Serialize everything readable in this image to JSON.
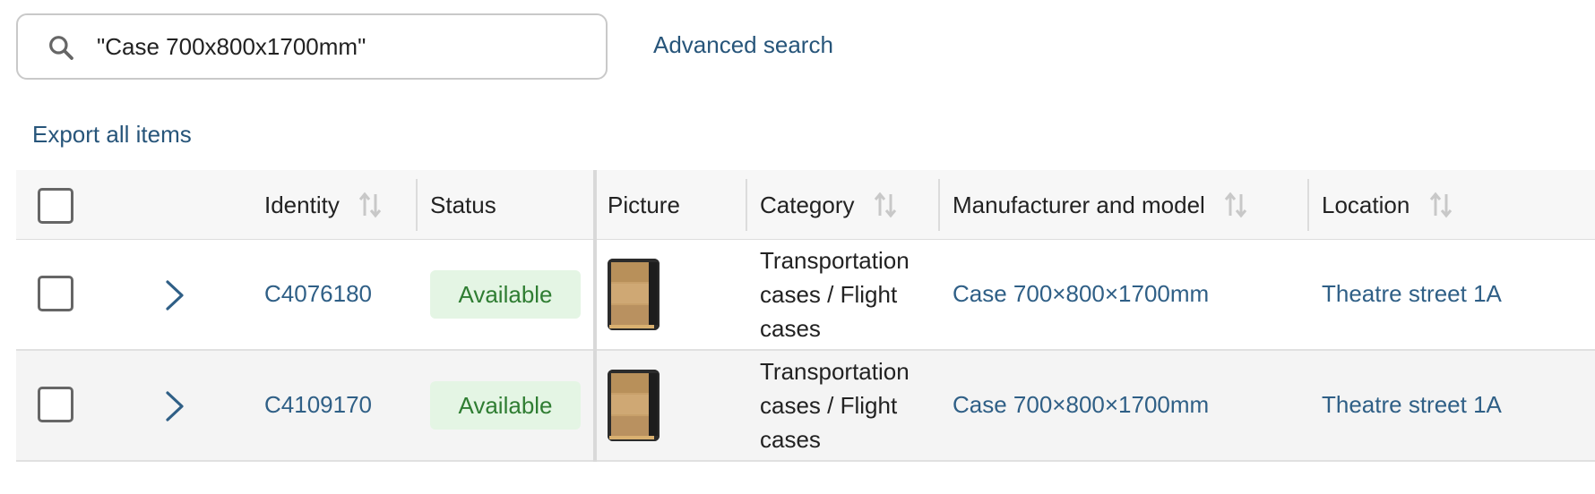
{
  "search": {
    "value": "\"Case 700x800x1700mm\"",
    "advanced_label": "Advanced search"
  },
  "export_label": "Export all items",
  "table": {
    "columns": {
      "identity": "Identity",
      "status": "Status",
      "picture": "Picture",
      "category": "Category",
      "manufacturer": "Manufacturer and model",
      "location": "Location"
    },
    "rows": [
      {
        "identity": "C4076180",
        "status": "Available",
        "category": "Transportation cases / Flight cases",
        "manufacturer": "Case 700×800×1700mm",
        "location": "Theatre street 1A"
      },
      {
        "identity": "C4109170",
        "status": "Available",
        "category": "Transportation cases / Flight cases",
        "manufacturer": "Case 700×800×1700mm",
        "location": "Theatre street 1A"
      }
    ]
  },
  "colors": {
    "link": "#2f5f86",
    "status_bg": "#e4f5e4",
    "status_text": "#2f7d32"
  }
}
